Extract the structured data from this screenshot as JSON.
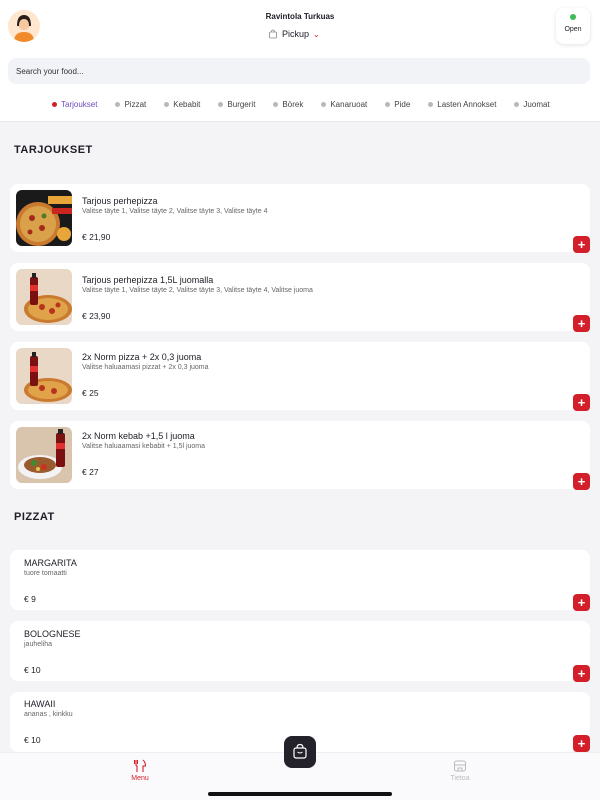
{
  "header": {
    "restaurant_name": "Ravintola Turkuas",
    "mode": "Pickup",
    "status": "Open",
    "search_placeholder": "Search your food..."
  },
  "categories": [
    "Tarjoukset",
    "Pizzat",
    "Kebabit",
    "Burgerit",
    "Börek",
    "Kanaruoat",
    "Pide",
    "Lasten Annokset",
    "Juomat"
  ],
  "sections": {
    "offers": {
      "title": "TARJOUKSET",
      "items": [
        {
          "name": "Tarjous perhepizza",
          "desc": "Valitse täyte 1, Valitse täyte 2, Valitse täyte 3, Valitse täyte 4",
          "price": "€ 21,90"
        },
        {
          "name": "Tarjous perhepizza 1,5L juomalla",
          "desc": "Valitse täyte 1, Valitse täyte 2, Valitse täyte 3, Valitse täyte 4, Valitse juoma",
          "price": "€ 23,90"
        },
        {
          "name": "2x Norm pizza + 2x 0,3 juoma",
          "desc": "Valitse haluaamasi pizzat + 2x 0,3 juoma",
          "price": "€ 25"
        },
        {
          "name": "2x Norm kebab +1,5 l juoma",
          "desc": "Valitse haluaamasi kebabit + 1,5l juoma",
          "price": "€ 27"
        }
      ]
    },
    "pizzas": {
      "title": "PIZZAT",
      "items": [
        {
          "name": "MARGARITA",
          "desc": "tuore tomaatti",
          "price": "€ 9"
        },
        {
          "name": "BOLOGNESE",
          "desc": "jauheliha",
          "price": "€ 10"
        },
        {
          "name": "HAWAII",
          "desc": "ananas ,  kinkku",
          "price": "€ 10"
        }
      ]
    }
  },
  "nav": {
    "menu": "Menu",
    "info": "Tietoa"
  },
  "colors": {
    "accent": "#d31f2a",
    "active_category": "#6e4bbf",
    "status": "#3dbb54"
  }
}
